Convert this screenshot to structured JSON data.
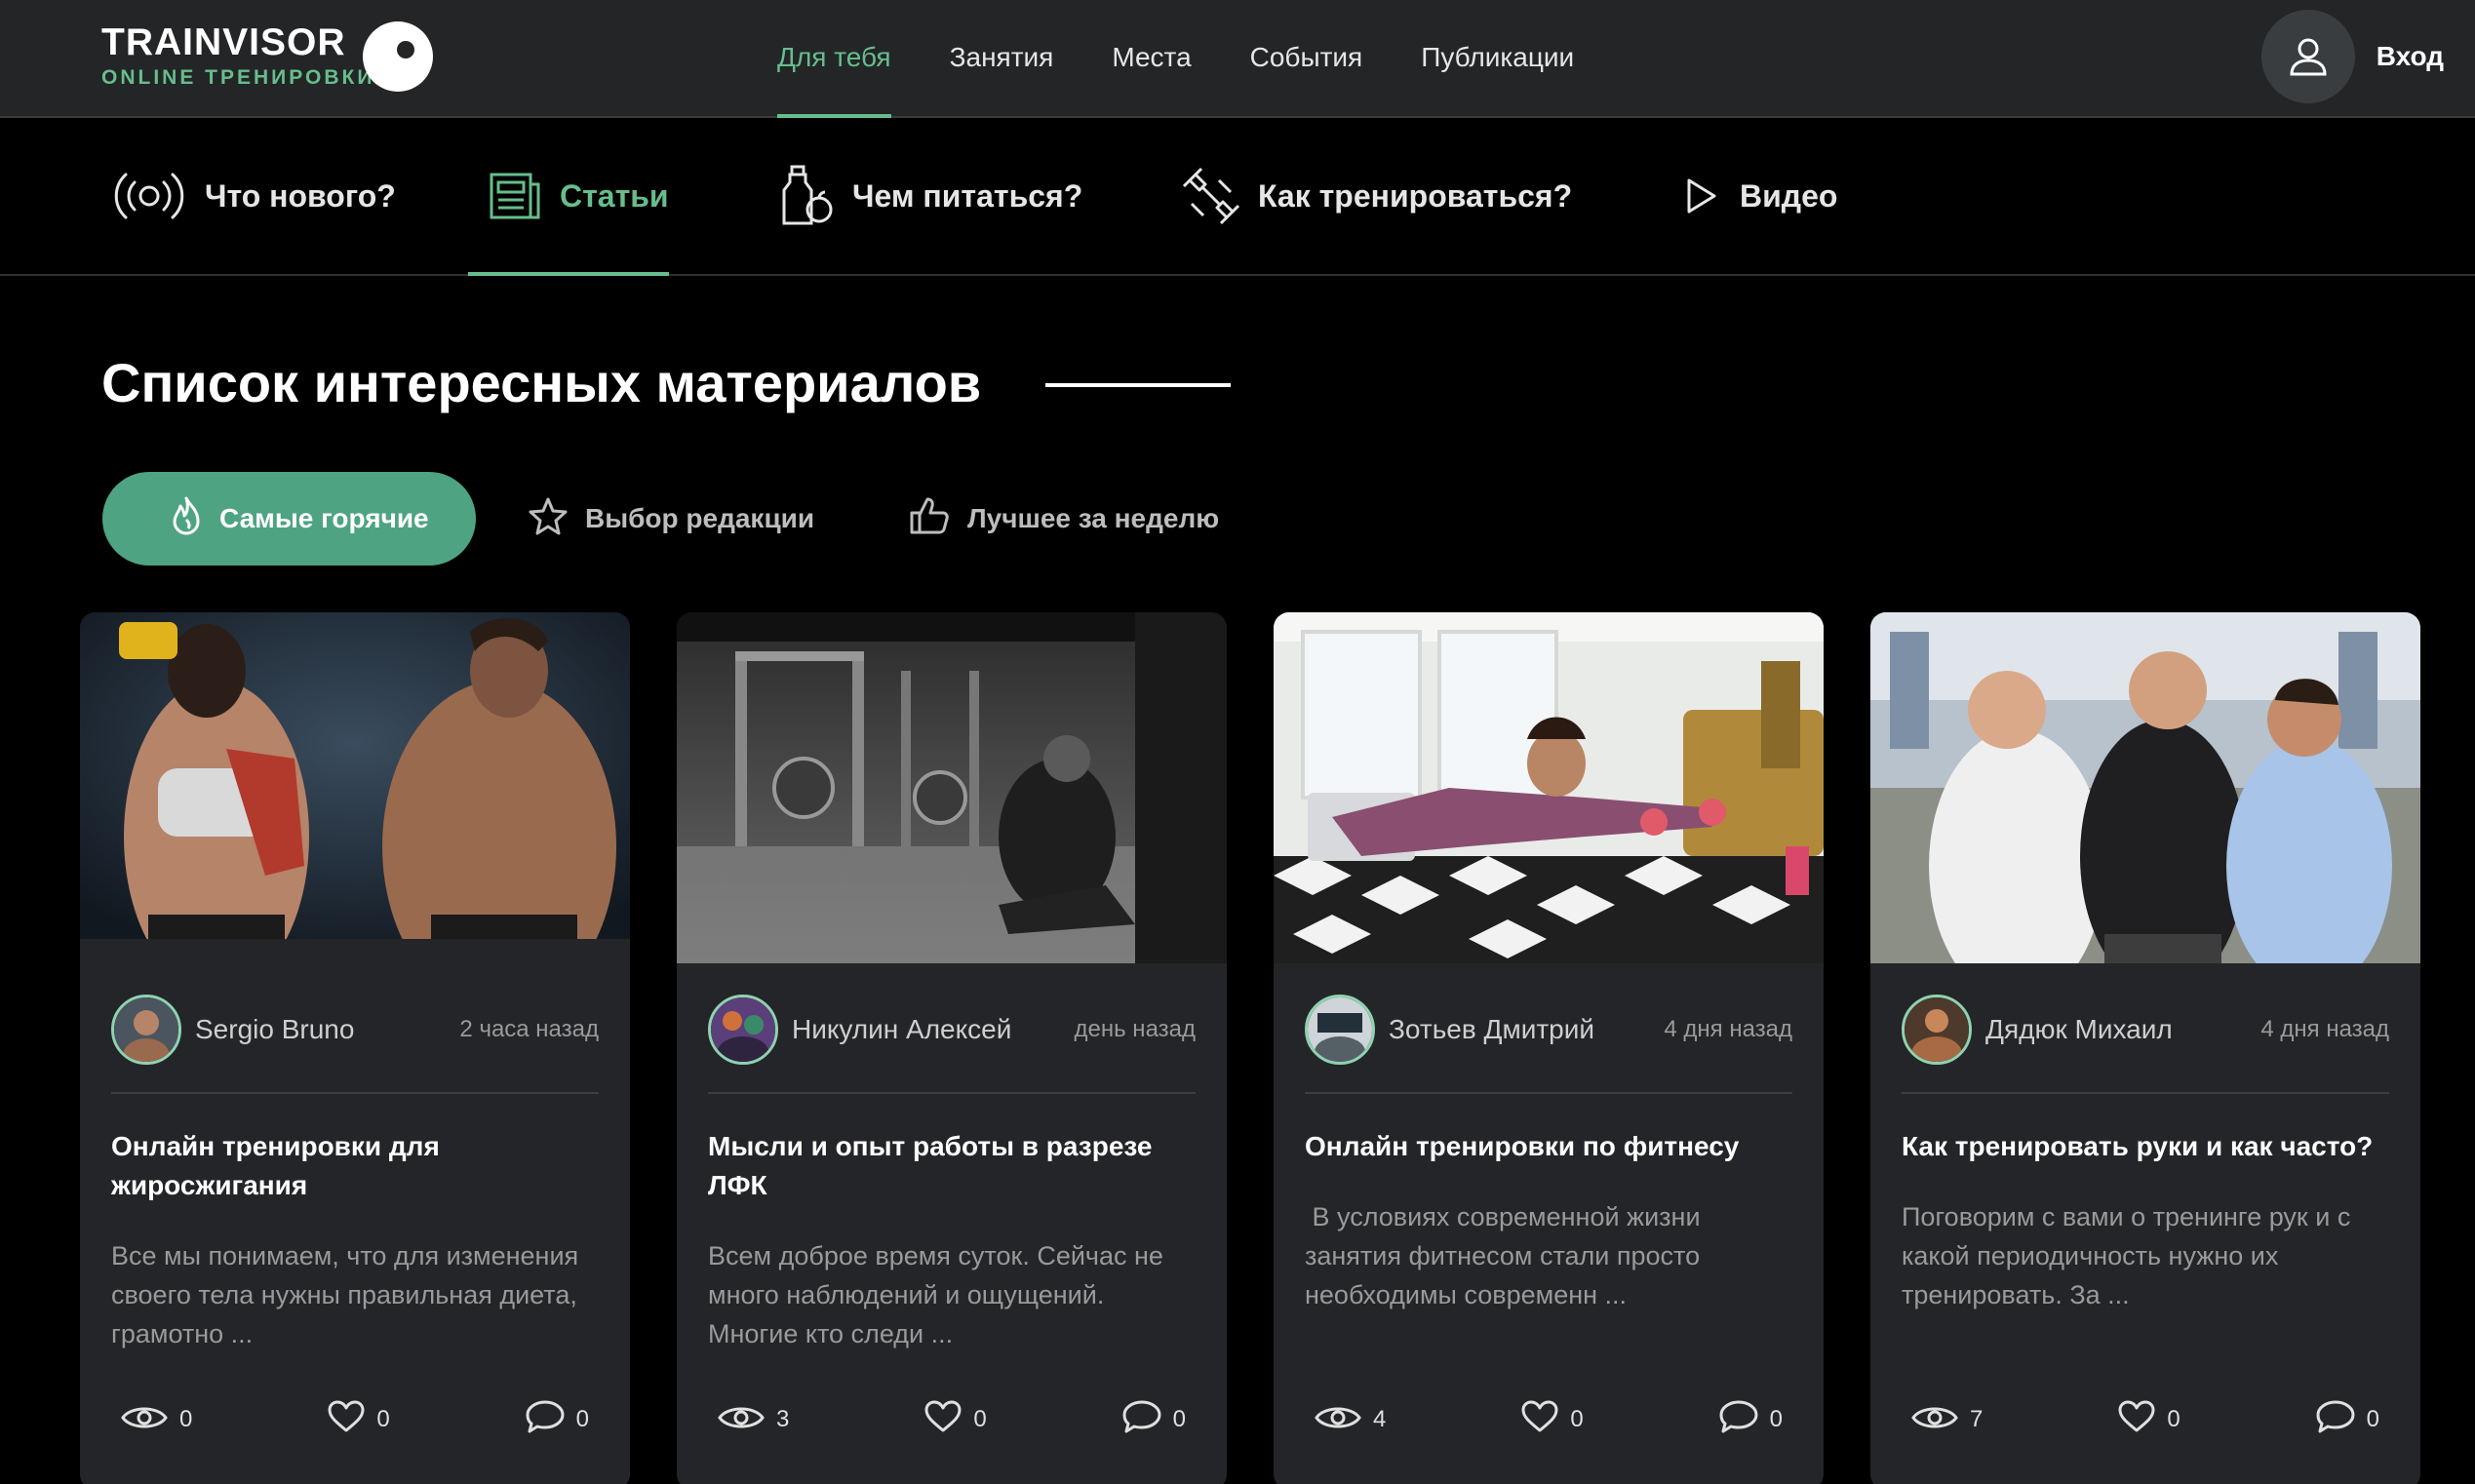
{
  "header": {
    "logo_title": "TRAINVISOR",
    "logo_subtitle": "ONLINE ТРЕНИРОВКИ",
    "nav": [
      {
        "label": "Для тебя",
        "active": true
      },
      {
        "label": "Занятия",
        "active": false
      },
      {
        "label": "Места",
        "active": false
      },
      {
        "label": "События",
        "active": false
      },
      {
        "label": "Публикации",
        "active": false
      }
    ],
    "login_label": "Вход"
  },
  "subnav": [
    {
      "label": "Что нового?",
      "icon": "broadcast-icon",
      "active": false
    },
    {
      "label": "Статьи",
      "icon": "article-icon",
      "active": true
    },
    {
      "label": "Чем питаться?",
      "icon": "nutrition-icon",
      "active": false
    },
    {
      "label": "Как тренироваться?",
      "icon": "dumbbell-icon",
      "active": false
    },
    {
      "label": "Видео",
      "icon": "play-icon",
      "active": false
    }
  ],
  "section": {
    "title": "Список интересных материалов"
  },
  "filters": [
    {
      "label": "Самые горячие",
      "icon": "flame-icon",
      "active": true
    },
    {
      "label": "Выбор редакции",
      "icon": "star-icon",
      "active": false
    },
    {
      "label": "Лучшее за неделю",
      "icon": "thumbs-up-icon",
      "active": false
    }
  ],
  "cards": [
    {
      "author": "Sergio Bruno",
      "time": "2 часа назад",
      "title": "Онлайн тренировки для жиросжигания",
      "excerpt": "Все мы понимаем, что для изменения своего тела нужны правильная диета, грамотно ...",
      "views": "0",
      "likes": "0",
      "comments": "0"
    },
    {
      "author": "Никулин Алексей",
      "time": "день назад",
      "title": "Мысли и опыт работы в разрезе ЛФК",
      "excerpt": "Всем доброе время суток. Сейчас не много наблюдений и ощущений. Многие кто следи ...",
      "views": "3",
      "likes": "0",
      "comments": "0"
    },
    {
      "author": "Зотьев Дмитрий",
      "time": "4 дня назад",
      "title": "Онлайн тренировки по фитнесу",
      "excerpt": " В условиях современной жизни занятия фитнесом стали просто необходимы современн ...",
      "views": "4",
      "likes": "0",
      "comments": "0"
    },
    {
      "author": "Дядюк Михаил",
      "time": "4 дня назад",
      "title": "Как тренировать руки и как часто?",
      "excerpt": "Поговорим с вами о тренинге рук и с какой периодичность нужно их тренировать. За ...",
      "views": "7",
      "likes": "0",
      "comments": "0"
    }
  ],
  "colors": {
    "accent": "#67bd8c",
    "accent_button": "#4ea383",
    "header_bg": "#232527",
    "card_bg": "#232528",
    "page_bg": "#000000"
  }
}
